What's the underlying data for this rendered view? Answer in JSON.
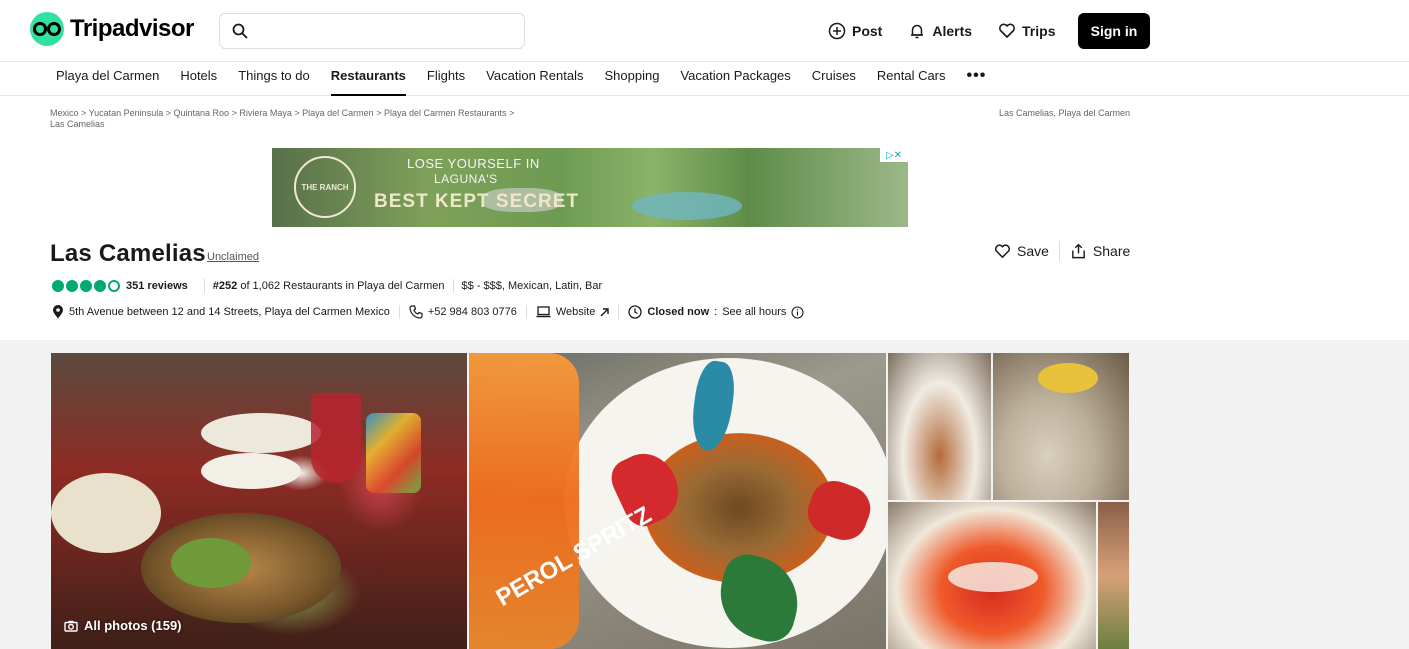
{
  "header": {
    "brand": "Tripadvisor",
    "search_placeholder": "",
    "post_label": "Post",
    "alerts_label": "Alerts",
    "trips_label": "Trips",
    "signin_label": "Sign in"
  },
  "nav": {
    "items": [
      {
        "label": "Playa del Carmen",
        "active": false
      },
      {
        "label": "Hotels",
        "active": false
      },
      {
        "label": "Things to do",
        "active": false
      },
      {
        "label": "Restaurants",
        "active": true
      },
      {
        "label": "Flights",
        "active": false
      },
      {
        "label": "Vacation Rentals",
        "active": false
      },
      {
        "label": "Shopping",
        "active": false
      },
      {
        "label": "Vacation Packages",
        "active": false
      },
      {
        "label": "Cruises",
        "active": false
      },
      {
        "label": "Rental Cars",
        "active": false
      }
    ],
    "more_label": "•••"
  },
  "breadcrumb": {
    "items": [
      "Mexico",
      "Yucatan Peninsula",
      "Quintana Roo",
      "Riviera Maya",
      "Playa del Carmen",
      "Playa del Carmen Restaurants",
      "Las Camelias"
    ],
    "separator": ">",
    "right_text": "Las Camelias, Playa del Carmen"
  },
  "ad": {
    "line1": "LOSE YOURSELF IN",
    "line2": "LAGUNA'S",
    "line3": "BEST KEPT SECRET",
    "seal_text": "THE RANCH"
  },
  "restaurant": {
    "name": "Las Camelias",
    "claim_status": "Unclaimed",
    "save_label": "Save",
    "share_label": "Share",
    "rating_bubbles_filled": 4,
    "rating_bubbles_total": 5,
    "reviews": "351 reviews",
    "rank_number": "#252",
    "rank_text": " of 1,062 Restaurants in Playa del Carmen",
    "price_cuisine": "$$ - $$$, Mexican, Latin, Bar",
    "address": "5th Avenue between 12 and 14 Streets, Playa del Carmen Mexico",
    "phone": "+52 984 803 0776",
    "website_label": "Website",
    "hours_status": "Closed now",
    "hours_link": "See all hours"
  },
  "gallery": {
    "all_photos_label": "All photos (159)",
    "spritz_text": "PEROL SPRITZ"
  },
  "colors": {
    "brand_green": "#34e0a1",
    "bubble_green": "#00aa6c",
    "signin_bg": "#000000"
  }
}
